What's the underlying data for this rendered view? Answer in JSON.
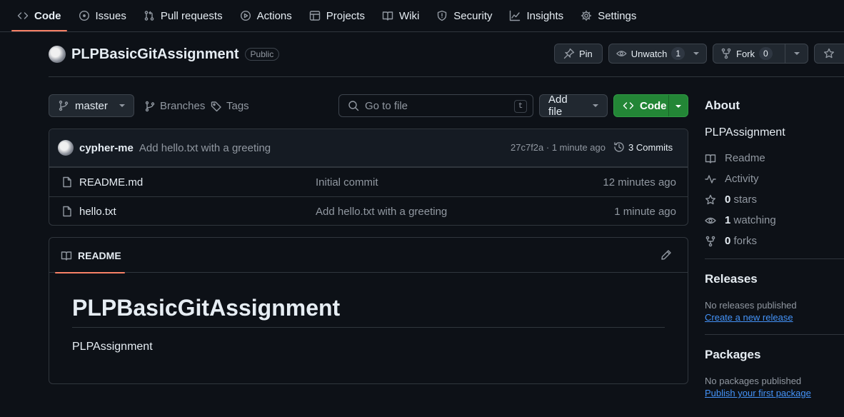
{
  "nav": {
    "tabs": [
      {
        "label": "Code",
        "icon": "code-icon"
      },
      {
        "label": "Issues",
        "icon": "issue-icon"
      },
      {
        "label": "Pull requests",
        "icon": "pull-request-icon"
      },
      {
        "label": "Actions",
        "icon": "play-icon"
      },
      {
        "label": "Projects",
        "icon": "table-icon"
      },
      {
        "label": "Wiki",
        "icon": "book-icon"
      },
      {
        "label": "Security",
        "icon": "shield-icon"
      },
      {
        "label": "Insights",
        "icon": "graph-icon"
      },
      {
        "label": "Settings",
        "icon": "gear-icon"
      }
    ],
    "active_tab": "Code"
  },
  "repo": {
    "name": "PLPBasicGitAssignment",
    "visibility": "Public",
    "actions": {
      "pin": "Pin",
      "unwatch": "Unwatch",
      "watch_count": "1",
      "fork": "Fork",
      "fork_count": "0"
    }
  },
  "toolbar": {
    "branch": "master",
    "branches": "Branches",
    "tags": "Tags",
    "search_placeholder": "Go to file",
    "search_shortcut": "t",
    "add_file": "Add file",
    "code": "Code"
  },
  "latest_commit": {
    "author": "cypher-me",
    "message": "Add hello.txt with a greeting",
    "hash_time": "27c7f2a · 1 minute ago",
    "commits": "3 Commits"
  },
  "files": [
    {
      "name": "README.md",
      "message": "Initial commit",
      "time": "12 minutes ago"
    },
    {
      "name": "hello.txt",
      "message": "Add hello.txt with a greeting",
      "time": "1 minute ago"
    }
  ],
  "readme": {
    "tab": "README",
    "heading": "PLPBasicGitAssignment",
    "body": "PLPAssignment"
  },
  "about": {
    "title": "About",
    "description": "PLPAssignment",
    "readme": "Readme",
    "activity": "Activity",
    "stars_count": "0",
    "stars_label": "stars",
    "watching_count": "1",
    "watching_label": "watching",
    "forks_count": "0",
    "forks_label": "forks"
  },
  "releases": {
    "title": "Releases",
    "empty": "No releases published",
    "link": "Create a new release"
  },
  "packages": {
    "title": "Packages",
    "empty": "No packages published",
    "link": "Publish your first package"
  },
  "colors": {
    "background": "#0d1117",
    "border": "#30363d",
    "accent_underline": "#f78166",
    "primary_button": "#238636",
    "link": "#4493f8",
    "muted_text": "#9198a1"
  }
}
